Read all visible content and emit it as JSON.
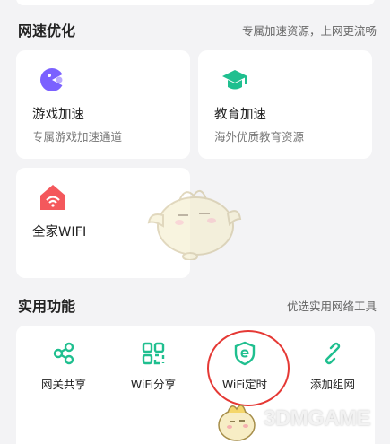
{
  "speed_section": {
    "title": "网速优化",
    "subtitle": "专属加速资源，上网更流畅"
  },
  "feature_cards": [
    {
      "title": "游戏加速",
      "desc": "专属游戏加速通道",
      "icon": "game-icon",
      "color": "#7b61ff"
    },
    {
      "title": "教育加速",
      "desc": "海外优质教育资源",
      "icon": "graduation-cap-icon",
      "color": "#1fbf8f"
    },
    {
      "title": "全家WIFI",
      "desc": "",
      "icon": "home-wifi-icon",
      "color": "#f4585c"
    }
  ],
  "tools_section": {
    "title": "实用功能",
    "subtitle": "优选实用网络工具"
  },
  "tools": [
    {
      "label": "网关共享",
      "icon": "share-icon"
    },
    {
      "label": "WiFi分享",
      "icon": "qr-code-icon"
    },
    {
      "label": "WiFi定时",
      "icon": "shield-timer-icon"
    },
    {
      "label": "添加组网",
      "icon": "link-icon"
    }
  ],
  "watermark": {
    "text": "3DMGAME"
  },
  "colors": {
    "accent_green": "#1fbf8f",
    "highlight_red": "#e53935"
  }
}
